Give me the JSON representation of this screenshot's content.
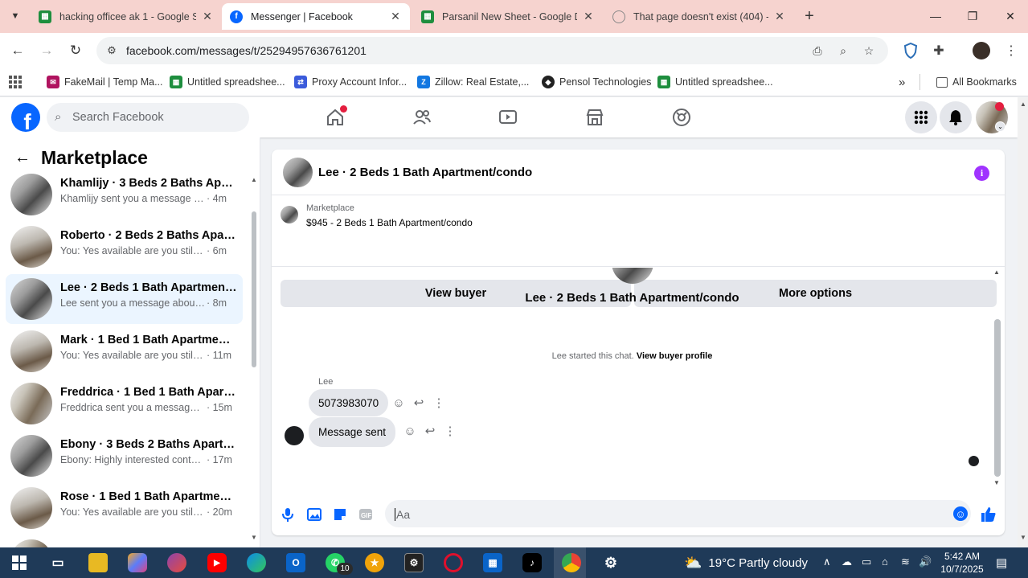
{
  "browser": {
    "tabs": [
      {
        "title": "hacking officee ak 1 - Google Sh",
        "favicon": "sheets-icon",
        "active": false
      },
      {
        "title": "Messenger | Facebook",
        "favicon": "facebook-icon",
        "active": true
      },
      {
        "title": "Parsanil New Sheet - Google Dr",
        "favicon": "sheets-icon",
        "active": false
      },
      {
        "title": "That page doesn't exist (404) - F",
        "favicon": "globe-icon",
        "active": false
      }
    ],
    "url": "facebook.com/messages/t/25294957636761201",
    "bookmarks": [
      {
        "label": "FakeMail | Temp Ma..."
      },
      {
        "label": "Untitled spreadshee..."
      },
      {
        "label": "Proxy Account Infor..."
      },
      {
        "label": "Zillow: Real Estate,..."
      },
      {
        "label": "Pensol Technologies"
      },
      {
        "label": "Untitled spreadshee..."
      }
    ],
    "all_bookmarks": "All Bookmarks"
  },
  "facebook": {
    "search_placeholder": "Search Facebook"
  },
  "sidebar": {
    "title": "Marketplace",
    "conversations": [
      {
        "name": "Khamlijy · 3 Beds 2 Baths Apart...",
        "snippet": "Khamlijy sent you a message abou...",
        "time": "· 4m"
      },
      {
        "name": "Roberto · 2 Beds 2 Baths Apart...",
        "snippet": "You: Yes available are you still inter...",
        "time": "· 6m"
      },
      {
        "name": "Lee · 2 Beds 1 Bath Apartment/c...",
        "snippet": "Lee sent you a message about you...",
        "time": "· 8m"
      },
      {
        "name": "Mark · 1 Bed 1 Bath Apartment/...",
        "snippet": "You: Yes available are you still int...",
        "time": "· 11m"
      },
      {
        "name": "Freddrica · 1 Bed 1 Bath Apartm...",
        "snippet": "Freddrica sent you a message ab...",
        "time": "· 15m"
      },
      {
        "name": "Ebony · 3 Beds 2 Baths Apartme...",
        "snippet": "Ebony: Highly interested contact ...",
        "time": "· 17m"
      },
      {
        "name": "Rose · 1 Bed 1 Bath Apartment/c...",
        "snippet": "You: Yes available are you still int...",
        "time": "· 20m"
      }
    ]
  },
  "chat": {
    "header_name": "Lee · 2 Beds 1 Bath Apartment/condo",
    "listing_category": "Marketplace",
    "listing_price": "$945 - 2 Beds 1 Bath Apartment/condo",
    "view_buyer": "View buyer",
    "more_options": "More options",
    "center_name": "Lee · 2 Beds 1 Bath Apartment/condo",
    "started_text": "Lee started this chat.",
    "view_buyer_profile": "View buyer profile",
    "sender": "Lee",
    "messages": [
      {
        "text": "5073983070"
      },
      {
        "text": "Message sent"
      }
    ],
    "input_placeholder": "Aa"
  },
  "taskbar": {
    "whatsapp_badge": "10",
    "weather_temp": "19°C",
    "weather_text": "Partly cloudy",
    "time": "5:42 AM",
    "date": "10/7/2025"
  },
  "colors": {
    "tabbar_bg": "#f6d3cf",
    "facebook_blue": "#0866ff",
    "selected_row": "#ebf5ff",
    "taskbar_bg": "#1f3a58",
    "info_purple": "#a033ff"
  }
}
